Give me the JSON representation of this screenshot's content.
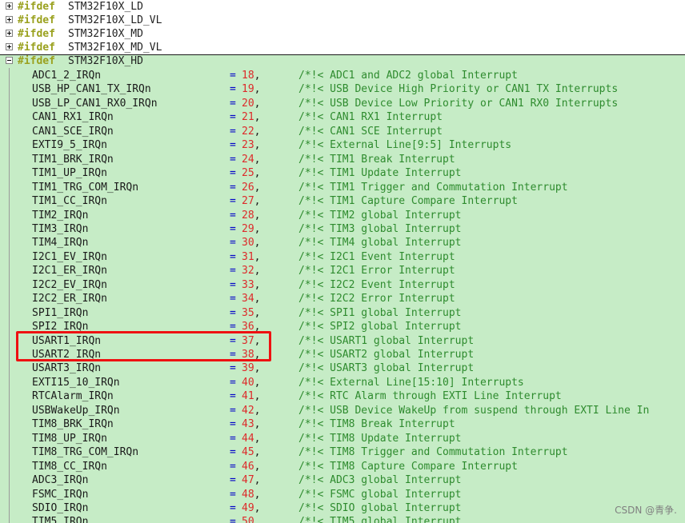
{
  "fold_headers": [
    {
      "keyword": "#ifdef",
      "symbol": "STM32F10X_LD",
      "state": "collapsed"
    },
    {
      "keyword": "#ifdef",
      "symbol": "STM32F10X_LD_VL",
      "state": "collapsed"
    },
    {
      "keyword": "#ifdef",
      "symbol": "STM32F10X_MD",
      "state": "collapsed"
    },
    {
      "keyword": "#ifdef",
      "symbol": "STM32F10X_MD_VL",
      "state": "collapsed"
    },
    {
      "keyword": "#ifdef",
      "symbol": "STM32F10X_HD",
      "state": "expanded"
    }
  ],
  "code_lines": [
    {
      "name": "ADC1_2_IRQn",
      "value": "18",
      "comment": "/*!< ADC1 and ADC2 global Interrupt"
    },
    {
      "name": "USB_HP_CAN1_TX_IRQn",
      "value": "19",
      "comment": "/*!< USB Device High Priority or CAN1 TX Interrupts"
    },
    {
      "name": "USB_LP_CAN1_RX0_IRQn",
      "value": "20",
      "comment": "/*!< USB Device Low Priority or CAN1 RX0 Interrupts"
    },
    {
      "name": "CAN1_RX1_IRQn",
      "value": "21",
      "comment": "/*!< CAN1 RX1 Interrupt"
    },
    {
      "name": "CAN1_SCE_IRQn",
      "value": "22",
      "comment": "/*!< CAN1 SCE Interrupt"
    },
    {
      "name": "EXTI9_5_IRQn",
      "value": "23",
      "comment": "/*!< External Line[9:5] Interrupts"
    },
    {
      "name": "TIM1_BRK_IRQn",
      "value": "24",
      "comment": "/*!< TIM1 Break Interrupt"
    },
    {
      "name": "TIM1_UP_IRQn",
      "value": "25",
      "comment": "/*!< TIM1 Update Interrupt"
    },
    {
      "name": "TIM1_TRG_COM_IRQn",
      "value": "26",
      "comment": "/*!< TIM1 Trigger and Commutation Interrupt"
    },
    {
      "name": "TIM1_CC_IRQn",
      "value": "27",
      "comment": "/*!< TIM1 Capture Compare Interrupt"
    },
    {
      "name": "TIM2_IRQn",
      "value": "28",
      "comment": "/*!< TIM2 global Interrupt"
    },
    {
      "name": "TIM3_IRQn",
      "value": "29",
      "comment": "/*!< TIM3 global Interrupt"
    },
    {
      "name": "TIM4_IRQn",
      "value": "30",
      "comment": "/*!< TIM4 global Interrupt"
    },
    {
      "name": "I2C1_EV_IRQn",
      "value": "31",
      "comment": "/*!< I2C1 Event Interrupt"
    },
    {
      "name": "I2C1_ER_IRQn",
      "value": "32",
      "comment": "/*!< I2C1 Error Interrupt"
    },
    {
      "name": "I2C2_EV_IRQn",
      "value": "33",
      "comment": "/*!< I2C2 Event Interrupt"
    },
    {
      "name": "I2C2_ER_IRQn",
      "value": "34",
      "comment": "/*!< I2C2 Error Interrupt"
    },
    {
      "name": "SPI1_IRQn",
      "value": "35",
      "comment": "/*!< SPI1 global Interrupt"
    },
    {
      "name": "SPI2_IRQn",
      "value": "36",
      "comment": "/*!< SPI2 global Interrupt"
    },
    {
      "name": "USART1_IRQn",
      "value": "37",
      "comment": "/*!< USART1 global Interrupt"
    },
    {
      "name": "USART2_IRQn",
      "value": "38",
      "comment": "/*!< USART2 global Interrupt"
    },
    {
      "name": "USART3_IRQn",
      "value": "39",
      "comment": "/*!< USART3 global Interrupt"
    },
    {
      "name": "EXTI15_10_IRQn",
      "value": "40",
      "comment": "/*!< External Line[15:10] Interrupts"
    },
    {
      "name": "RTCAlarm_IRQn",
      "value": "41",
      "comment": "/*!< RTC Alarm through EXTI Line Interrupt"
    },
    {
      "name": "USBWakeUp_IRQn",
      "value": "42",
      "comment": "/*!< USB Device WakeUp from suspend through EXTI Line In"
    },
    {
      "name": "TIM8_BRK_IRQn",
      "value": "43",
      "comment": "/*!< TIM8 Break Interrupt"
    },
    {
      "name": "TIM8_UP_IRQn",
      "value": "44",
      "comment": "/*!< TIM8 Update Interrupt"
    },
    {
      "name": "TIM8_TRG_COM_IRQn",
      "value": "45",
      "comment": "/*!< TIM8 Trigger and Commutation Interrupt"
    },
    {
      "name": "TIM8_CC_IRQn",
      "value": "46",
      "comment": "/*!< TIM8 Capture Compare Interrupt"
    },
    {
      "name": "ADC3_IRQn",
      "value": "47",
      "comment": "/*!< ADC3 global Interrupt"
    },
    {
      "name": "FSMC_IRQn",
      "value": "48",
      "comment": "/*!< FSMC global Interrupt"
    },
    {
      "name": "SDIO_IRQn",
      "value": "49",
      "comment": "/*!< SDIO global Interrupt"
    },
    {
      "name": "TIM5_IRQn",
      "value": "50",
      "comment": "/*!< TIM5 global Interrupt"
    }
  ],
  "highlighted_lines": [
    "USART1_IRQn",
    "USART2_IRQn"
  ],
  "watermark": "CSDN @青争.",
  "colors": {
    "background": "#c6ecc6",
    "preprocessor": "#9aa11e",
    "operator": "#0000c8",
    "number": "#dd2a2a",
    "comment": "#2e8b2e",
    "highlight_box": "#ee1111"
  }
}
